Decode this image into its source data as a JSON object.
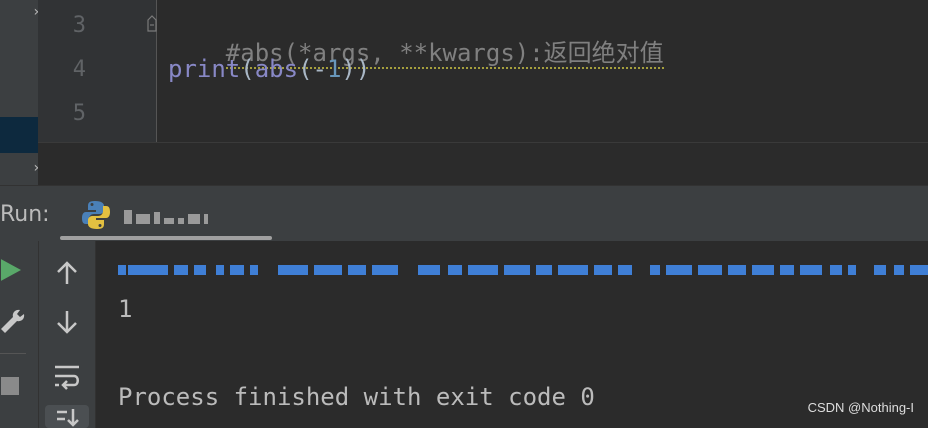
{
  "editor": {
    "line_numbers": [
      "3",
      "4",
      "5"
    ],
    "line3": {
      "comment": "#abs(*args, **kwargs):返回绝对值"
    },
    "line4": {
      "fn1": "print",
      "p1": "(",
      "fn2": "abs",
      "p2": "(",
      "minus": "-",
      "num": "1",
      "p3": "))"
    }
  },
  "run": {
    "label": "Run:",
    "tab_name_visible": false
  },
  "console": {
    "output": "1",
    "status": "Process finished with exit code 0"
  },
  "watermark": "CSDN @Nothing-I",
  "colors": {
    "background": "#2b2b2b",
    "panel": "#3c3f41",
    "comment": "#808080",
    "builtin": "#8888c6",
    "number": "#6897bb",
    "run_green": "#59a869",
    "link_blue": "#3f7fd6"
  }
}
